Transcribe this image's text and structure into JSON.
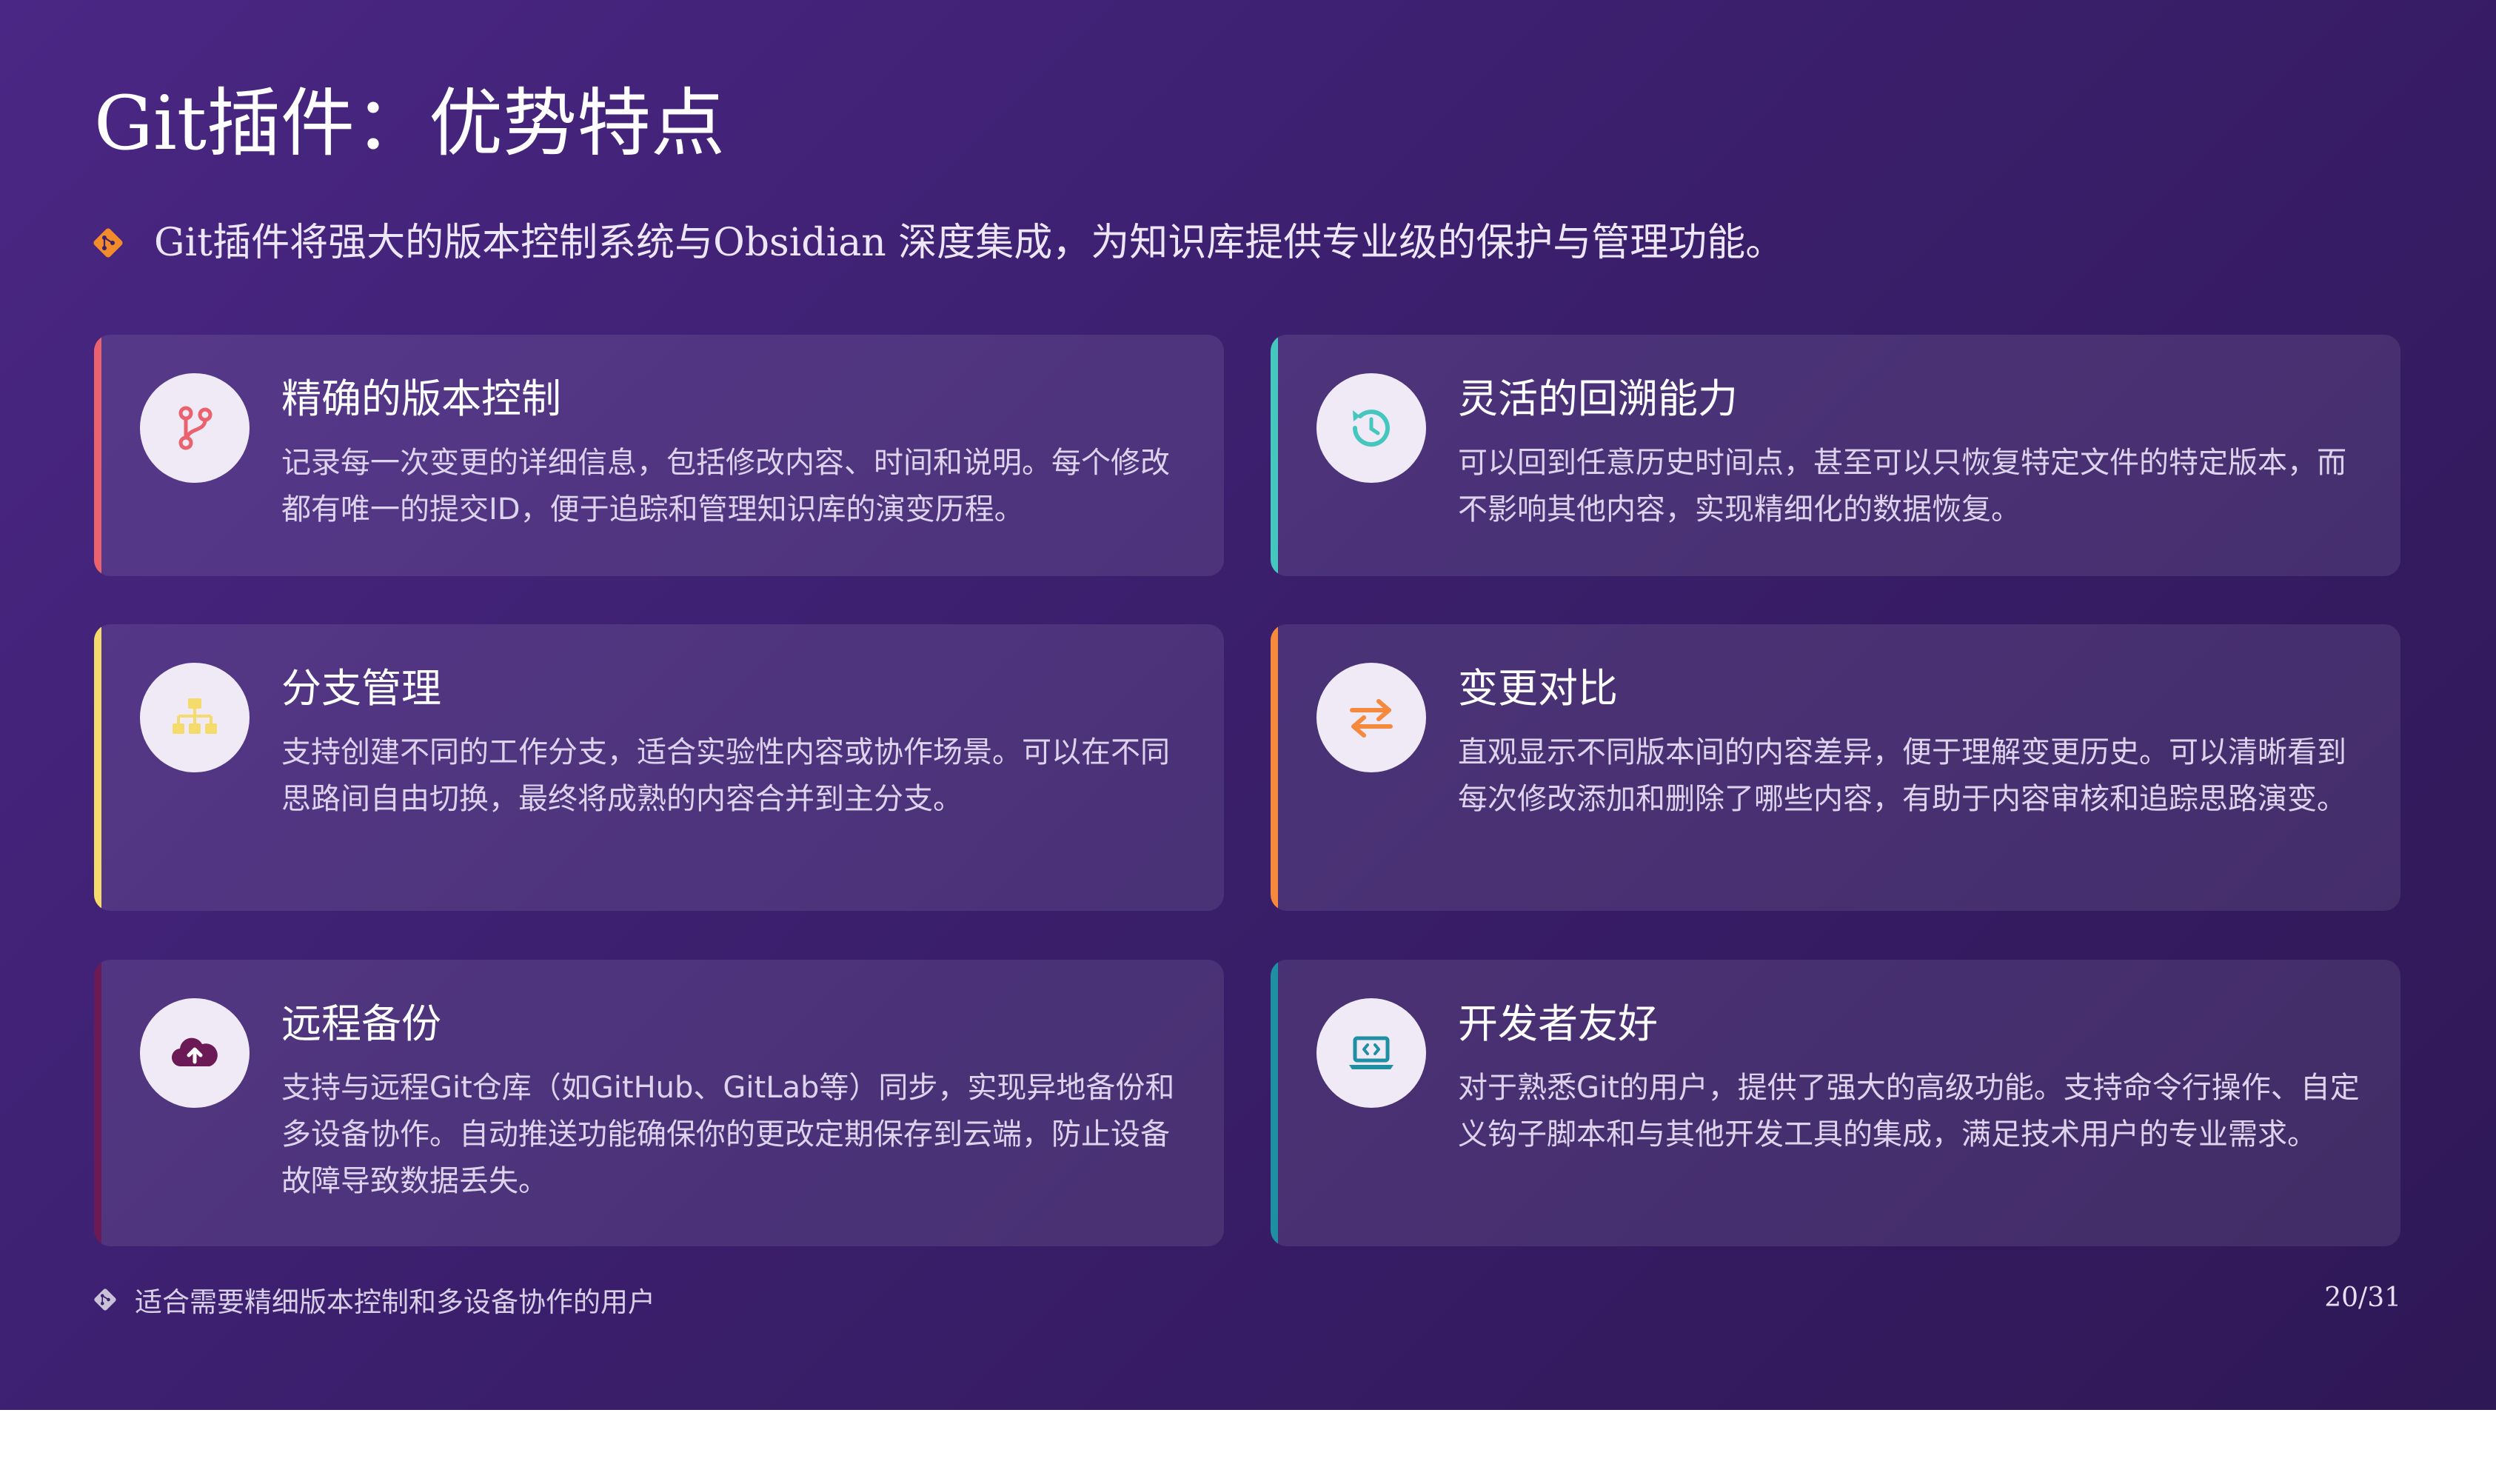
{
  "slide": {
    "title": "Git插件：优势特点",
    "subtitle": "Git插件将强大的版本控制系统与Obsidian 深度集成，为知识库提供专业级的保护与管理功能。",
    "subtitle_icon": "git-diamond-icon",
    "footer": "适合需要精细版本控制和多设备协作的用户",
    "footer_icon": "git-diamond-icon",
    "page_number": "20/31"
  },
  "colors": {
    "git_orange": "#f28b2b",
    "bar_red": "#e9626e",
    "bar_teal": "#45c6be",
    "bar_yellow": "#f4db6b",
    "bar_orange": "#f58a3e",
    "bar_purple": "#6b1a55",
    "bar_blue": "#1f8fa3"
  },
  "cards": [
    {
      "title": "精确的版本控制",
      "description": "记录每一次变更的详细信息，包括修改内容、时间和说明。每个修改都有唯一的提交ID，便于追踪和管理知识库的演变历程。",
      "icon": "code-branch-icon",
      "accent": "#e9626e"
    },
    {
      "title": "灵活的回溯能力",
      "description": "可以回到任意历史时间点，甚至可以只恢复特定文件的特定版本，而不影响其他内容，实现精细化的数据恢复。",
      "icon": "history-icon",
      "accent": "#45c6be"
    },
    {
      "title": "分支管理",
      "description": "支持创建不同的工作分支，适合实验性内容或协作场景。可以在不同思路间自由切换，最终将成熟的内容合并到主分支。",
      "icon": "sitemap-icon",
      "accent": "#f4db6b"
    },
    {
      "title": "变更对比",
      "description": "直观显示不同版本间的内容差异，便于理解变更历史。可以清晰看到每次修改添加和删除了哪些内容，有助于内容审核和追踪思路演变。",
      "icon": "exchange-arrows-icon",
      "accent": "#f58a3e"
    },
    {
      "title": "远程备份",
      "description": "支持与远程Git仓库（如GitHub、GitLab等）同步，实现异地备份和多设备协作。自动推送功能确保你的更改定期保存到云端，防止设备故障导致数据丢失。",
      "icon": "cloud-upload-icon",
      "accent": "#6b1a55"
    },
    {
      "title": "开发者友好",
      "description": "对于熟悉Git的用户，提供了强大的高级功能。支持命令行操作、自定义钩子脚本和与其他开发工具的集成，满足技术用户的专业需求。",
      "icon": "laptop-code-icon",
      "accent": "#1f8fa3"
    }
  ]
}
